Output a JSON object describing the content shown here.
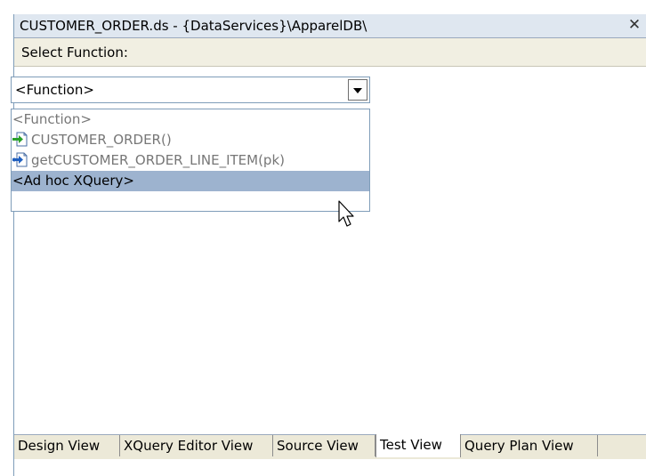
{
  "window": {
    "title": "CUSTOMER_ORDER.ds - {DataServices}\\ApparelDB\\",
    "close_glyph": "✕"
  },
  "select_function": {
    "label": "Select Function:"
  },
  "dropdown": {
    "value": "<Function>",
    "options": [
      {
        "label": "<Function>",
        "icon": ""
      },
      {
        "label": "CUSTOMER_ORDER()",
        "icon": "read-function-icon"
      },
      {
        "label": "getCUSTOMER_ORDER_LINE_ITEM(pk)",
        "icon": "navigate-function-icon"
      },
      {
        "label": "<Ad hoc XQuery>",
        "icon": "",
        "highlighted": true
      }
    ]
  },
  "tabs": [
    {
      "label": "Design View"
    },
    {
      "label": "XQuery Editor View"
    },
    {
      "label": "Source View"
    },
    {
      "label": "Test View",
      "active": true
    },
    {
      "label": "Query Plan View"
    }
  ],
  "colors": {
    "highlight": "#9db3cf",
    "titlebar": "#dfe7f0",
    "selectbar": "#f1efe2"
  }
}
